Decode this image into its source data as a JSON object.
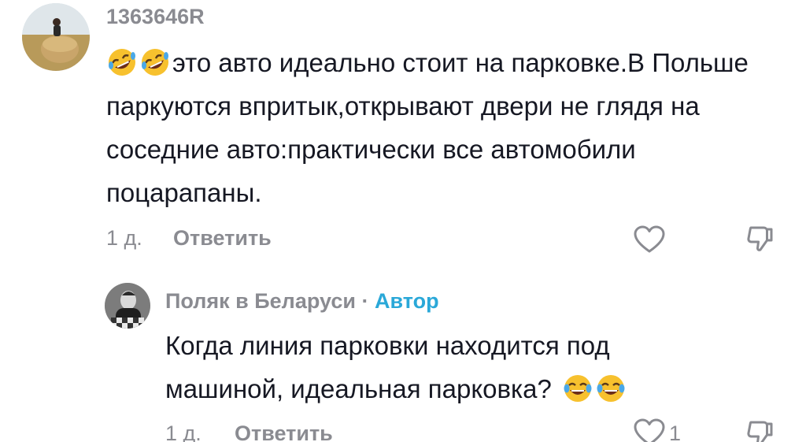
{
  "comments": [
    {
      "username": "1363646R",
      "emojis": [
        "rofl-emoji",
        "rofl-emoji"
      ],
      "text": "это авто идеально стоит на парковке.В Польше паркуются впритык,открывают двери не глядя на соседние авто:практически все автомобили поцарапаны.",
      "time": "1 д.",
      "reply_label": "Ответить",
      "icons": {
        "like": "heart-icon",
        "dislike": "thumbs-down-icon"
      }
    },
    {
      "username": "Поляк в Беларуси",
      "separator": "·",
      "badge": "Автор",
      "text": "Когда линия парковки находится под машиной, идеальная парковка?",
      "emojis_after": [
        "tears-of-joy-emoji",
        "tears-of-joy-emoji"
      ],
      "time": "1 д.",
      "reply_label": "Ответить",
      "like_count": "1",
      "icons": {
        "like": "heart-icon",
        "dislike": "thumbs-down-icon"
      },
      "badge_color": "#2aa8d8"
    }
  ],
  "colors": {
    "text": "#161823",
    "muted": "#8a8b91",
    "accent": "#2aa8d8"
  }
}
